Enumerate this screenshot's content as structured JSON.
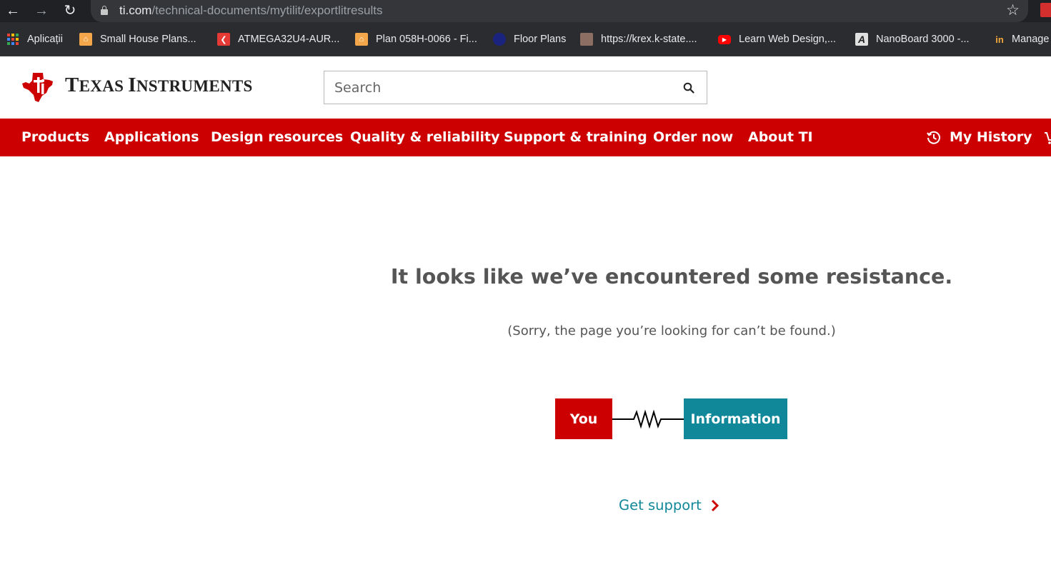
{
  "browser": {
    "url_domain": "ti.com",
    "url_path": "/technical-documents/mytilit/exportlitresults",
    "bookmarks": [
      {
        "label": "Aplicații",
        "icon": "apps-grid-icon"
      },
      {
        "label": "Small House Plans...",
        "icon": "house-icon"
      },
      {
        "label": "ATMEGA32U4-AUR...",
        "icon": "red-k-icon"
      },
      {
        "label": "Plan 058H-0066 - Fi...",
        "icon": "house-icon"
      },
      {
        "label": "Floor Plans",
        "icon": "blue-seal-icon"
      },
      {
        "label": "https://krex.k-state....",
        "icon": "wildcat-icon"
      },
      {
        "label": "Learn Web Design,...",
        "icon": "youtube-icon"
      },
      {
        "label": "NanoBoard 3000 -...",
        "icon": "altium-a-icon"
      },
      {
        "label": "Manage",
        "icon": "in-icon"
      }
    ]
  },
  "header": {
    "brand_first": "T",
    "brand_first_rest": "EXAS",
    "brand_second": "I",
    "brand_second_rest": "NSTRUMENTS",
    "search_placeholder": "Search"
  },
  "nav": {
    "items": [
      "Products",
      "Applications",
      "Design resources",
      "Quality & reliability",
      "Support & training",
      "Order now",
      "About TI"
    ],
    "history_label": "My History"
  },
  "error": {
    "title": "It looks like we’ve encountered some resistance.",
    "subtitle": "(Sorry, the page you’re looking for can’t be found.)",
    "left_block": "You",
    "right_block": "Information",
    "support_link": "Get support"
  },
  "colors": {
    "ti_red": "#cc0000",
    "teal": "#118899",
    "text_gray": "#555555",
    "chrome_dark": "#202124"
  }
}
